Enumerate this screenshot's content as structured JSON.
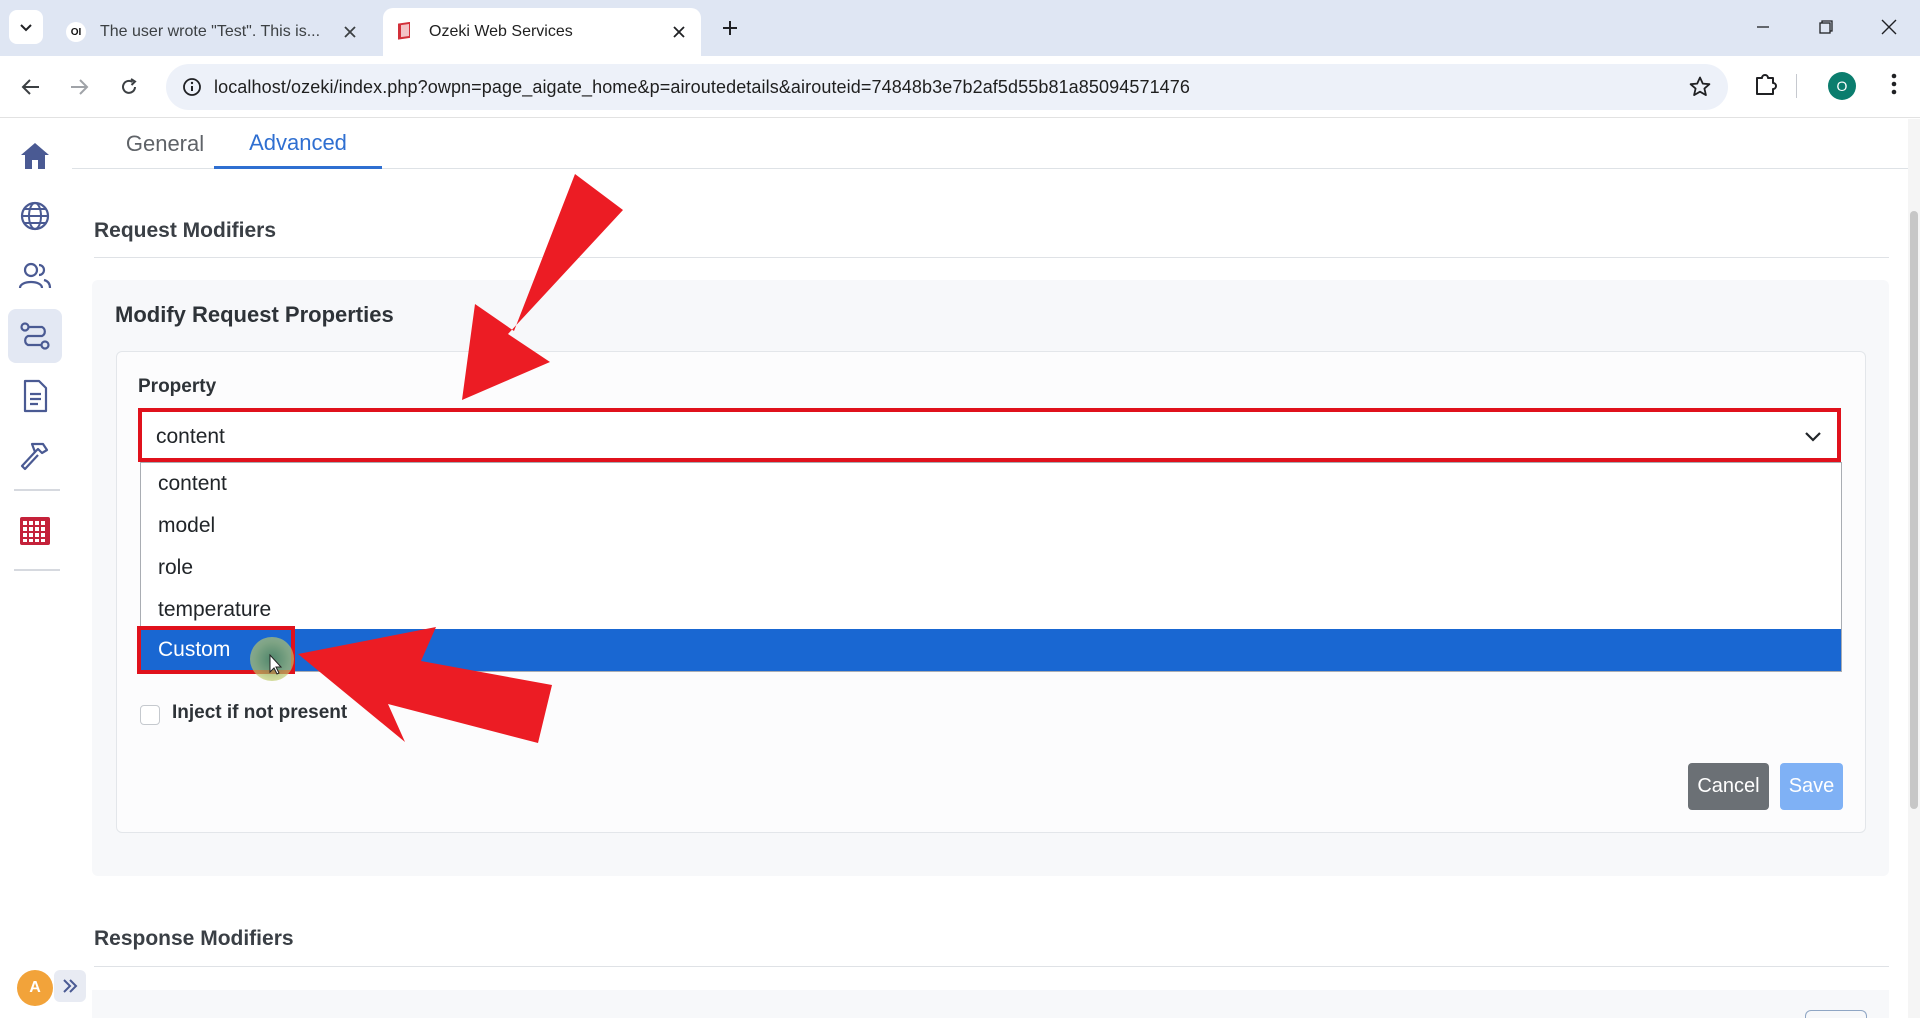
{
  "browser": {
    "tabs": [
      {
        "title": "The user wrote \"Test\". This is...",
        "favicon": "OI",
        "active": false
      },
      {
        "title": "Ozeki Web Services",
        "favicon": "ozeki-logo",
        "active": true
      }
    ],
    "url": "localhost/ozeki/index.php?owpn=page_aigate_home&p=airoutedetails&airouteid=74848b3e7b2af5d55b81a85094571476",
    "profile_initial": "O"
  },
  "sidebar": {
    "items": [
      {
        "name": "home-icon"
      },
      {
        "name": "globe-icon"
      },
      {
        "name": "users-icon"
      },
      {
        "name": "routes-icon",
        "active": true
      },
      {
        "name": "document-icon"
      },
      {
        "name": "hammer-icon"
      },
      {
        "name": "ozeki-apps-icon"
      }
    ],
    "avatar_initial": "A"
  },
  "page_tabs": [
    {
      "label": "General",
      "active": false
    },
    {
      "label": "Advanced",
      "active": true
    }
  ],
  "sections": {
    "request_modifiers": "Request Modifiers",
    "response_modifiers": "Response Modifiers"
  },
  "form": {
    "card_title": "Modify Request Properties",
    "property_label": "Property",
    "property_value": "content",
    "options": [
      "content",
      "model",
      "role",
      "temperature",
      "Custom"
    ],
    "highlighted_option": "Custom",
    "inject_label": "Inject if not present",
    "inject_checked": false,
    "cancel_label": "Cancel",
    "save_label": "Save"
  },
  "colors": {
    "accent": "#2f6fd1",
    "highlight": "#1967d2",
    "annotation_red": "#e0111c",
    "cancel": "#6b7075",
    "save": "#7fb1f5"
  }
}
